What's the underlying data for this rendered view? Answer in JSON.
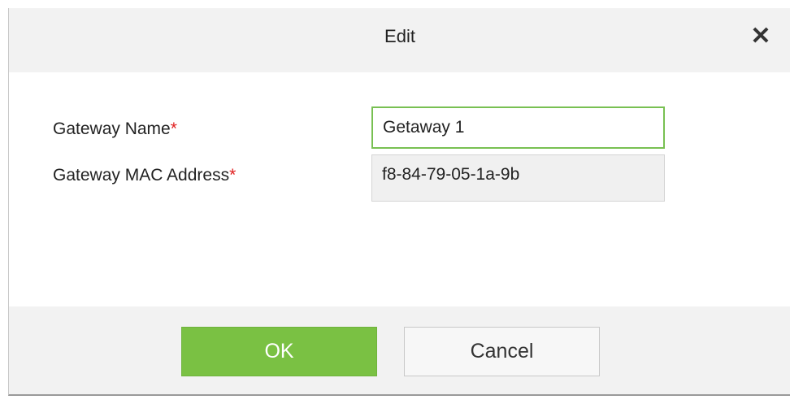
{
  "dialog": {
    "title": "Edit",
    "close_glyph": "✕"
  },
  "form": {
    "gateway_name_label": "Gateway Name",
    "gateway_name_value": "Getaway 1",
    "gateway_mac_label": "Gateway MAC Address",
    "gateway_mac_value": "f8-84-79-05-1a-9b",
    "required_marker": "*"
  },
  "buttons": {
    "ok_label": "OK",
    "cancel_label": "Cancel"
  },
  "colors": {
    "ok_button": "#7ac143",
    "input_focus_border": "#78c052",
    "required_marker": "#e02020"
  }
}
